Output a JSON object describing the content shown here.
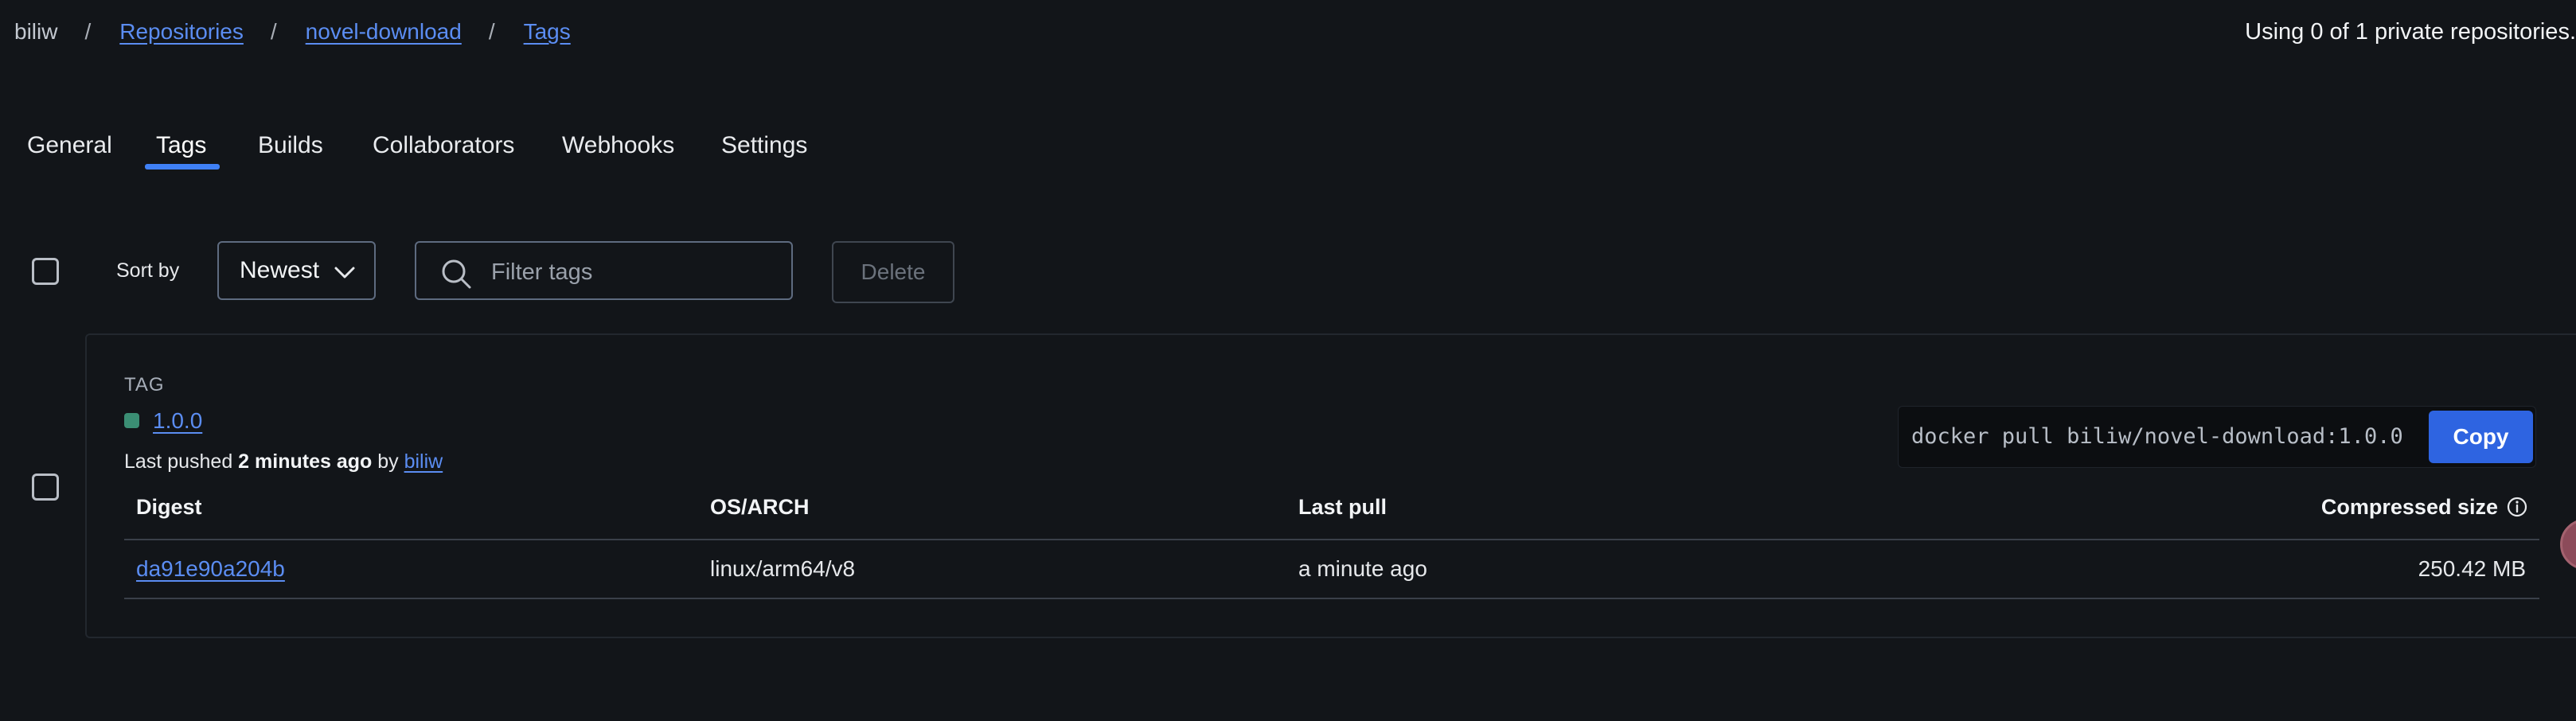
{
  "breadcrumb": {
    "namespace": "biliw",
    "separator": "/",
    "repositories": "Repositories",
    "repo": "novel-download",
    "current": "Tags"
  },
  "usage_text": "Using 0 of 1 private repositories.",
  "tabs": [
    {
      "label": "General",
      "active": false
    },
    {
      "label": "Tags",
      "active": true
    },
    {
      "label": "Builds",
      "active": false
    },
    {
      "label": "Collaborators",
      "active": false
    },
    {
      "label": "Webhooks",
      "active": false
    },
    {
      "label": "Settings",
      "active": false
    }
  ],
  "toolbar": {
    "sort_label": "Sort by",
    "sort_value": "Newest",
    "filter_placeholder": "Filter tags",
    "delete_label": "Delete"
  },
  "tag_card": {
    "caption": "TAG",
    "tag_name": "1.0.0",
    "pushed_prefix": "Last pushed",
    "pushed_time": "2 minutes ago",
    "pushed_by": "by",
    "pushed_user": "biliw",
    "pull_command": "docker pull biliw/novel-download:1.0.0",
    "copy_label": "Copy",
    "columns": {
      "digest": "Digest",
      "os_arch": "OS/ARCH",
      "last_pull": "Last pull",
      "compressed_size": "Compressed size"
    },
    "rows": [
      {
        "digest": "da91e90a204b",
        "os_arch": "linux/arm64/v8",
        "last_pull": "a minute ago",
        "compressed_size": "250.42 MB"
      }
    ]
  },
  "colors": {
    "background": "#121519",
    "accent": "#3f80f6",
    "link": "#5b8df2",
    "copy_button": "#2e64e1",
    "tag_status": "#3b8e74"
  }
}
